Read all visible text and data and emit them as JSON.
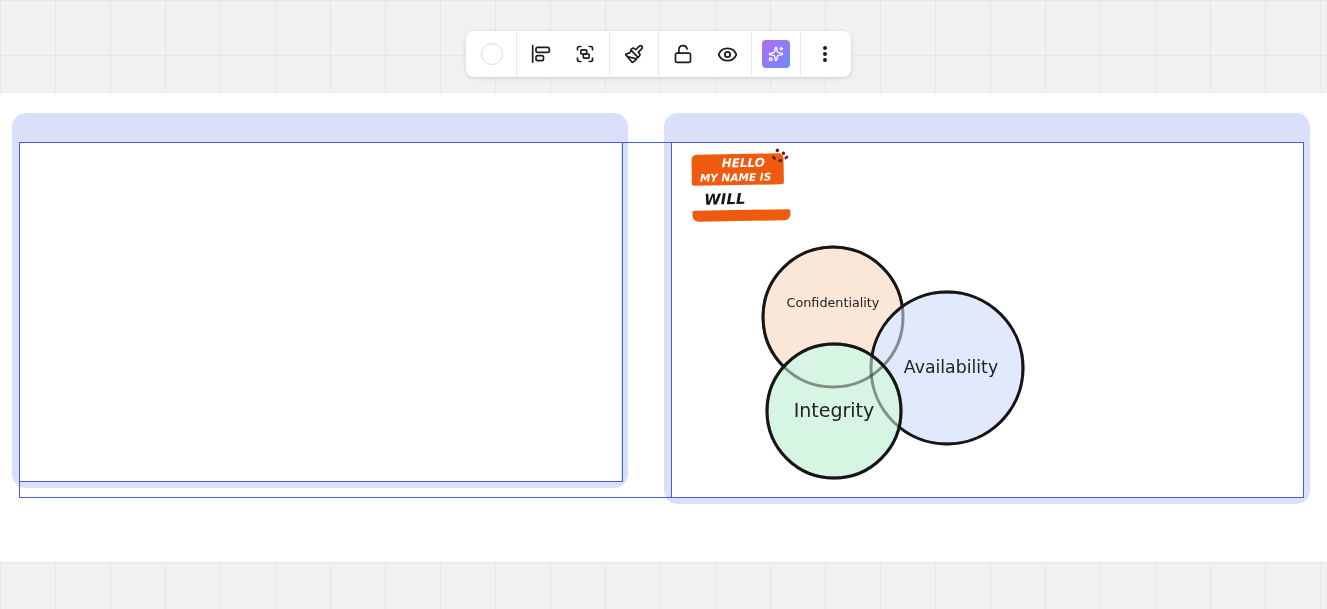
{
  "sticker": {
    "header_lines": [
      "HELLO",
      "MY NAME IS"
    ],
    "name": "WILL"
  },
  "venn": {
    "circles": [
      {
        "label": "Confidentiality",
        "color": "#fbe7d7"
      },
      {
        "label": "Availability",
        "color": "#e1e9fc"
      },
      {
        "label": "Integrity",
        "color": "#d6f5e3"
      }
    ]
  }
}
